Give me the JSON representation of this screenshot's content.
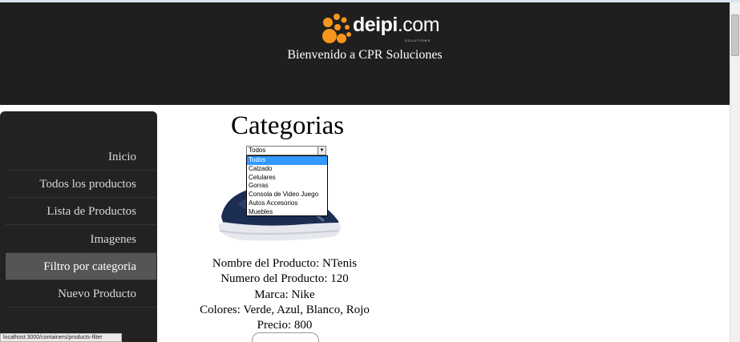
{
  "header": {
    "logo_brand": "deipi",
    "logo_domain": ".com",
    "logo_sub": "SOLUTIONS",
    "welcome": "Bienvenido a CPR Soluciones"
  },
  "sidebar": {
    "items": [
      {
        "label": "Inicio"
      },
      {
        "label": "Todos los productos"
      },
      {
        "label": "Lista de Productos"
      },
      {
        "label": "Imagenes"
      },
      {
        "label": "Filtro por categoria",
        "active": true
      },
      {
        "label": "Nuevo Producto"
      }
    ]
  },
  "main": {
    "title": "Categorias",
    "category_select": {
      "selected": "Todos",
      "options": [
        "Todos",
        "Calzado",
        "Celulares",
        "Gorras",
        "Consola de Video Juego",
        "Autos Accesorios",
        "Muebles"
      ]
    },
    "product": {
      "image_icon": "sneaker-image",
      "name_line": "Nombre del Producto: NTenis",
      "number_line": "Numero del Producto: 120",
      "brand_line": "Marca: Nike",
      "colors_line": "Colores: Verde, Azul, Blanco, Rojo",
      "price_line": "Precio: 800"
    }
  },
  "status_bar": {
    "url": "localhost:3000/containers/products-filter"
  },
  "colors": {
    "header_bg": "#1f1f1f",
    "sidebar_bg": "#222222",
    "sidebar_active": "#555555",
    "logo_orange": "#f7941d",
    "select_highlight": "#3399ff"
  }
}
